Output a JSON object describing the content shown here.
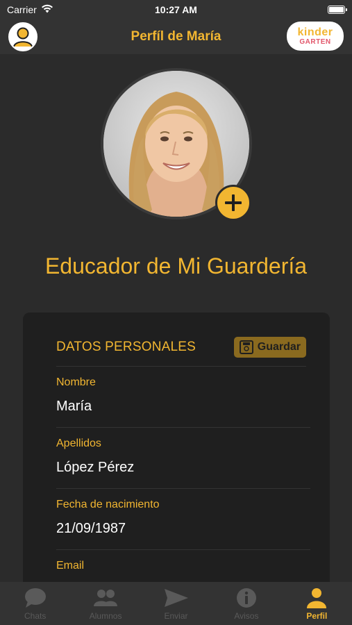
{
  "status_bar": {
    "carrier": "Carrier",
    "time": "10:27 AM",
    "battery_level": 1.0
  },
  "nav": {
    "title": "Perfíl de María",
    "logo_top": "kinder",
    "logo_bottom": "GARTEN"
  },
  "profile": {
    "role": "Educador de Mi Guardería"
  },
  "personal_data": {
    "section_title": "DATOS PERSONALES",
    "save_label": "Guardar",
    "fields": [
      {
        "label": "Nombre",
        "value": "María"
      },
      {
        "label": "Apellidos",
        "value": "López Pérez"
      },
      {
        "label": "Fecha de nacimiento",
        "value": "21/09/1987"
      },
      {
        "label": "Email",
        "value": ""
      }
    ]
  },
  "tabs": [
    {
      "label": "Chats",
      "icon": "chat-bubble-icon",
      "active": false
    },
    {
      "label": "Alumnos",
      "icon": "people-icon",
      "active": false
    },
    {
      "label": "Enviar",
      "icon": "send-icon",
      "active": false
    },
    {
      "label": "Avisos",
      "icon": "info-icon",
      "active": false
    },
    {
      "label": "Perfil",
      "icon": "person-icon",
      "active": true
    }
  ],
  "colors": {
    "accent": "#f2b631",
    "background": "#2b2b2b",
    "card": "#1f1f1f",
    "bar": "#333333"
  }
}
